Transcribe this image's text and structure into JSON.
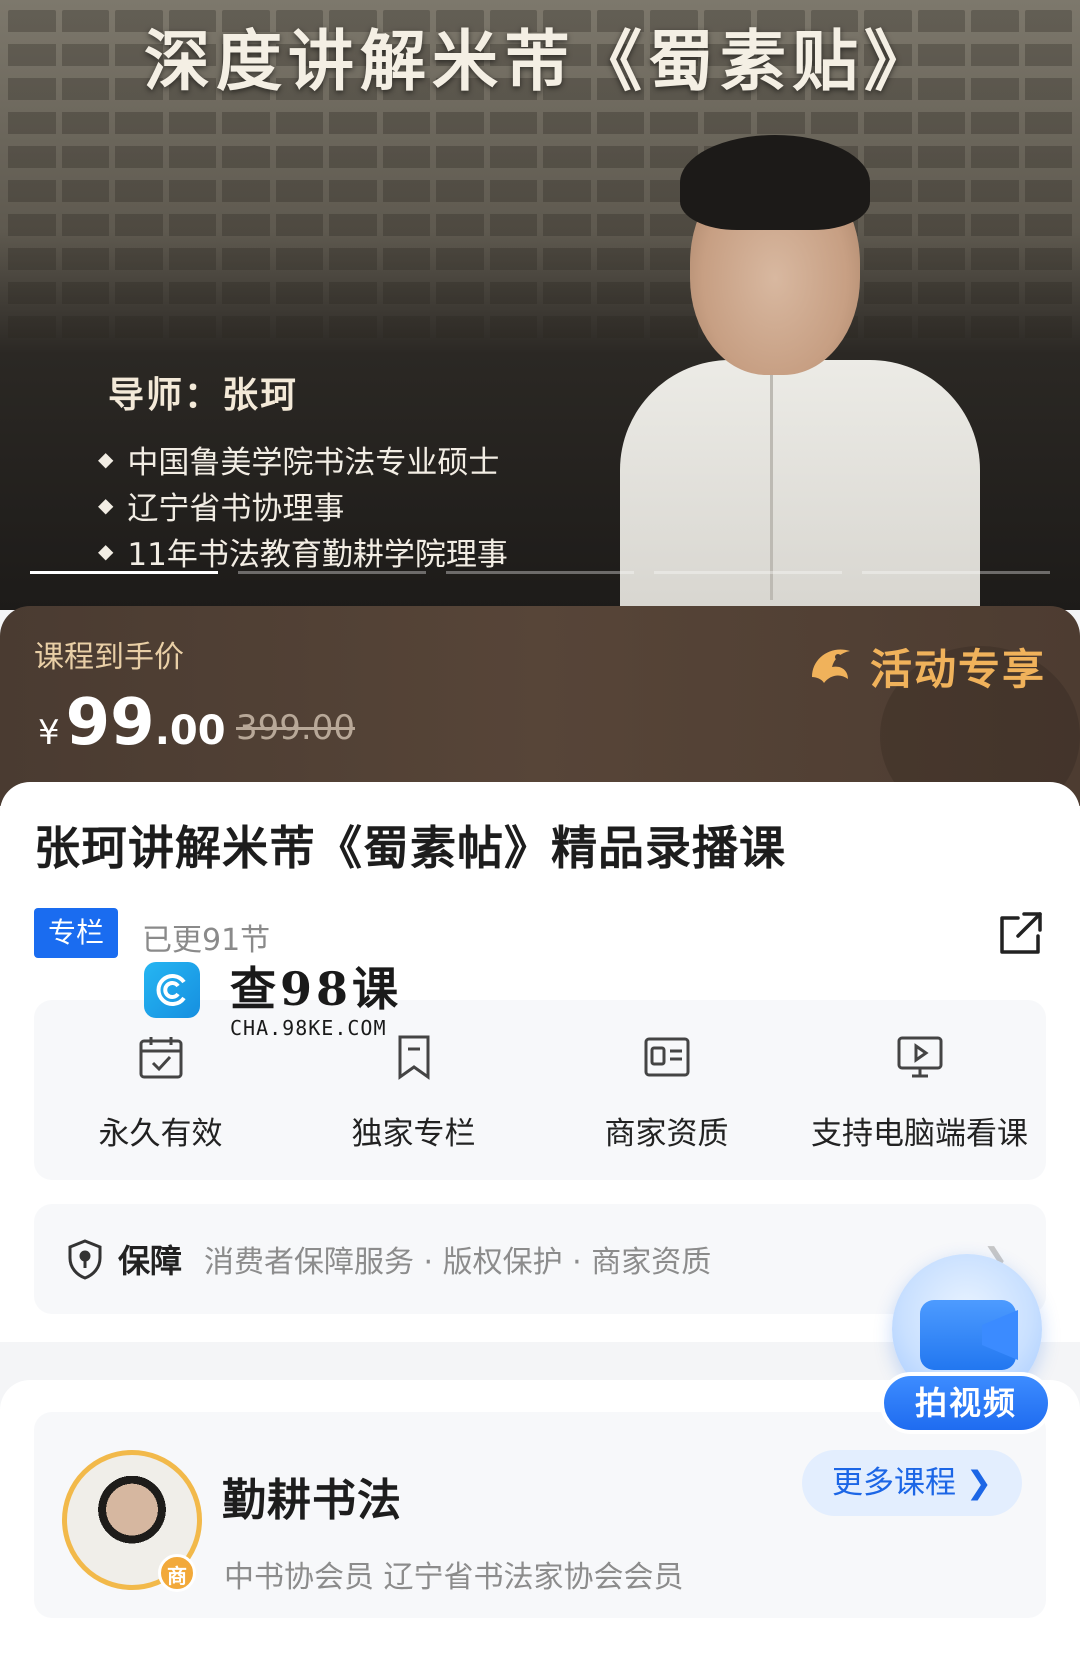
{
  "hero": {
    "title": "深度讲解米芾《蜀素贴》",
    "mentor": "导师：张珂",
    "credentials": [
      "中国鲁美学院书法专业硕士",
      "辽宁省书协理事",
      "11年书法教育勤耕学院理事"
    ],
    "slide_count": 5,
    "active_slide": 1
  },
  "price": {
    "label": "课程到手价",
    "currency": "¥",
    "now_int": "99",
    "now_dec": ".00",
    "original": "399.00",
    "promo_label": "活动专享"
  },
  "course": {
    "title": "张珂讲解米芾《蜀素帖》精品录播课",
    "tag": "专栏",
    "updates": "已更91节"
  },
  "watermark": {
    "title": "查98课",
    "subtitle": "CHA.98KE.COM"
  },
  "features": [
    {
      "label": "永久有效",
      "icon": "calendar-check-icon"
    },
    {
      "label": "独家专栏",
      "icon": "bookmark-icon"
    },
    {
      "label": "商家资质",
      "icon": "id-card-icon"
    },
    {
      "label": "支持电脑端看课",
      "icon": "monitor-play-icon"
    }
  ],
  "guarantee": {
    "title": "保障",
    "items": "消费者保障服务 · 版权保护 · 商家资质"
  },
  "float_button": {
    "label": "拍视频"
  },
  "shop": {
    "name": "勤耕书法",
    "description": "中书协会员 辽宁省书法家协会会员",
    "badge": "商",
    "more_label": "更多课程"
  },
  "colors": {
    "primary_blue": "#1a6cf0",
    "promo_gold": "#f0b25b",
    "price_band": "#574538"
  }
}
